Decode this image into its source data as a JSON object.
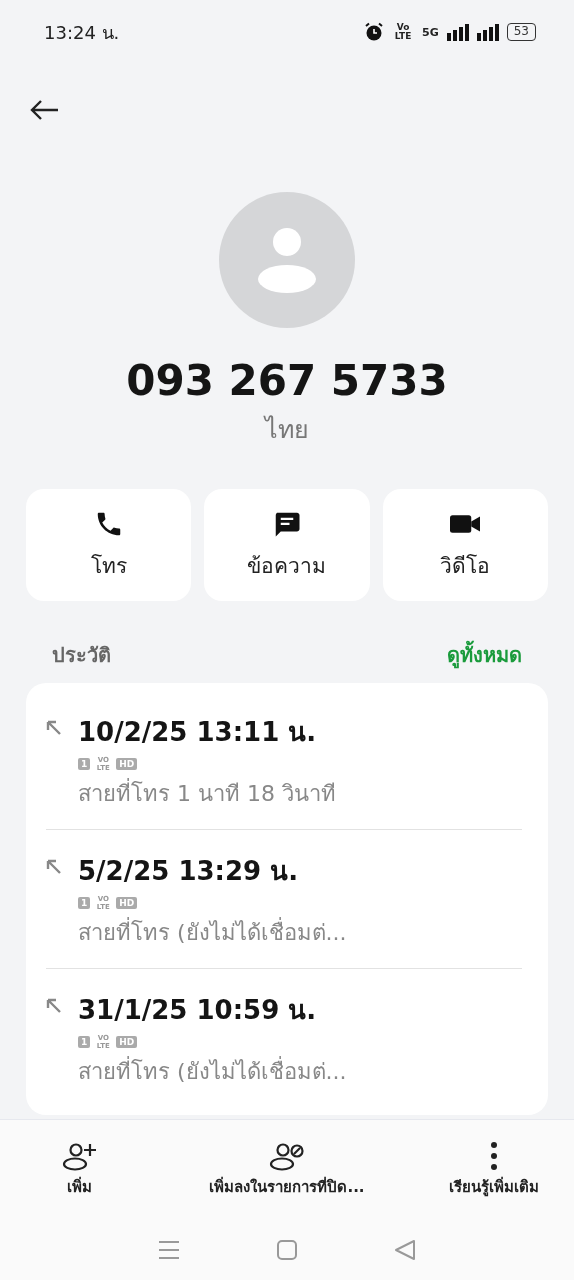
{
  "status_bar": {
    "time": "13:24 น.",
    "volte": "Vo LTE",
    "network": "5G",
    "battery": "53"
  },
  "contact": {
    "number": "093 267 5733",
    "location": "ไทย"
  },
  "actions": [
    {
      "kind": "call",
      "label": "โทร"
    },
    {
      "kind": "message",
      "label": "ข้อความ"
    },
    {
      "kind": "video",
      "label": "วิดีโอ"
    }
  ],
  "history": {
    "title": "ประวัติ",
    "see_all": "ดูทั้งหมด",
    "calls": [
      {
        "kind": "outgoing",
        "time": "10/2/25 13:11 น.",
        "sim": "1",
        "volte": "VO LTE",
        "hd": "HD",
        "detail": "สายที่โทร  1 นาที 18 วินาที"
      },
      {
        "kind": "outgoing",
        "time": "5/2/25 13:29 น.",
        "sim": "1",
        "volte": "VO LTE",
        "hd": "HD",
        "detail": "สายที่โทร (ยังไม่ได้เชื่อมต่..."
      },
      {
        "kind": "outgoing",
        "time": "31/1/25 10:59 น.",
        "sim": "1",
        "volte": "VO LTE",
        "hd": "HD",
        "detail": "สายที่โทร (ยังไม่ได้เชื่อมต่..."
      }
    ]
  },
  "bottom_actions": [
    {
      "kind": "add",
      "label": "เพิ่ม"
    },
    {
      "kind": "block",
      "label": "เพิ่มลงในรายการที่ปิด..."
    },
    {
      "kind": "more",
      "label": "เรียนรู้เพิ่มเติม"
    }
  ]
}
